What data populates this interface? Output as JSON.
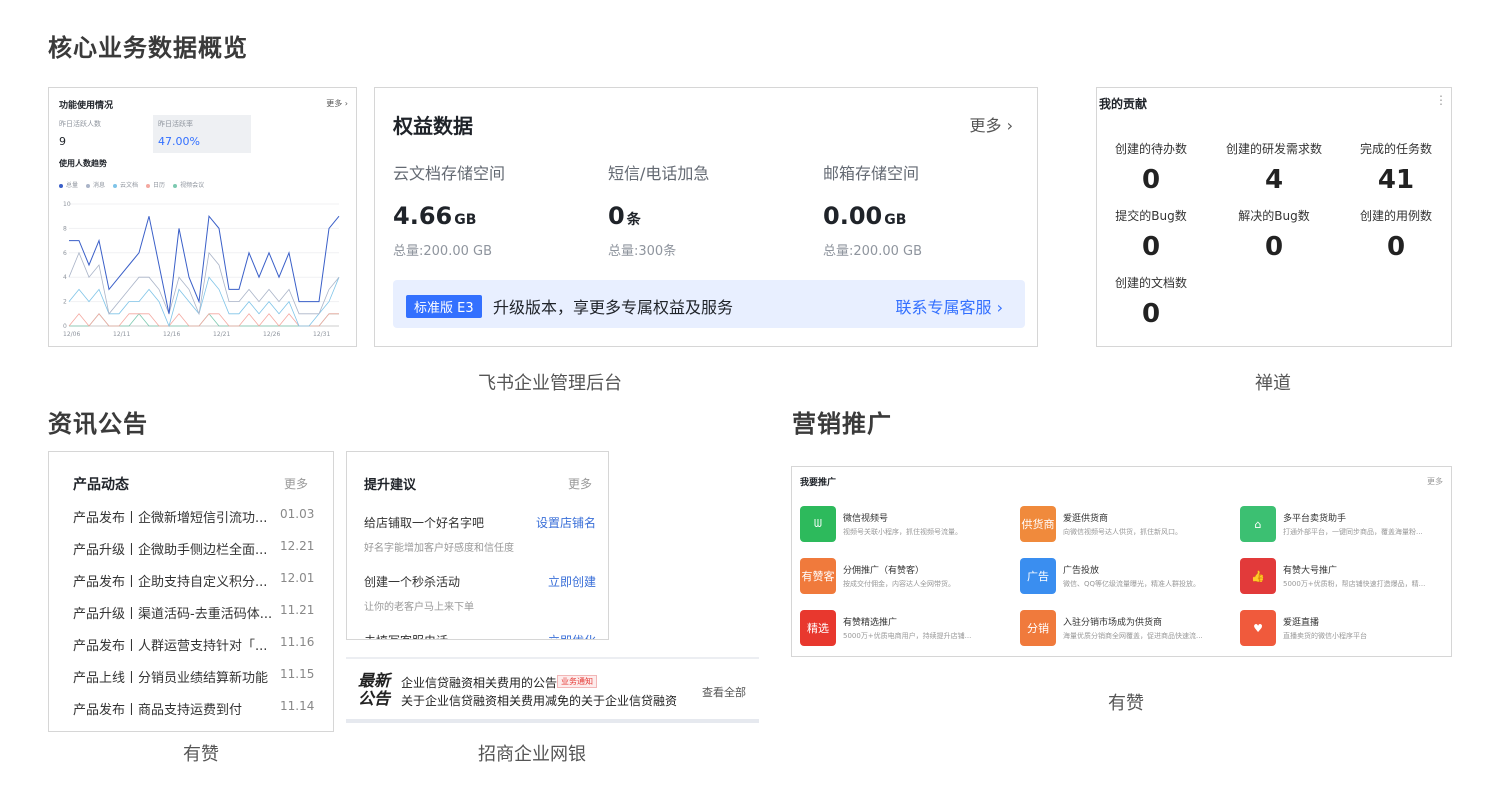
{
  "sections": {
    "core": "核心业务数据概览",
    "news": "资讯公告",
    "marketing": "营销推广"
  },
  "captions": {
    "feishu": "飞书企业管理后台",
    "chandao": "禅道",
    "youzan_news": "有赞",
    "cmb": "招商企业网银",
    "youzan_market": "有赞"
  },
  "usage_card": {
    "title": "功能使用情况",
    "more": "更多 ›",
    "stats": [
      {
        "label": "昨日活跃人数",
        "value": "9"
      },
      {
        "label": "昨日活跃率",
        "value": "47.00%"
      }
    ],
    "subtitle": "使用人数趋势",
    "legend": [
      "总量",
      "消息",
      "云文档",
      "日历",
      "视频会议"
    ],
    "colors": [
      "#3a5fc8",
      "#aab4c8",
      "#7fc4e8",
      "#f4a8a0",
      "#7cc9b0"
    ]
  },
  "chart_data": {
    "type": "line",
    "x_ticks": [
      "12/06",
      "12/11",
      "12/16",
      "12/21",
      "12/26",
      "12/31"
    ],
    "ylim": [
      0,
      10
    ],
    "y_ticks": [
      "0",
      "2",
      "4",
      "6",
      "8",
      "10"
    ],
    "series": [
      {
        "name": "总量",
        "values": [
          7,
          7,
          5,
          7,
          3,
          4,
          5,
          6,
          9,
          5,
          1,
          8,
          4,
          2,
          9,
          8,
          3,
          3,
          6,
          4,
          6,
          4,
          6,
          2,
          2,
          2,
          8,
          9
        ]
      },
      {
        "name": "消息",
        "values": [
          4,
          6,
          4,
          5,
          1,
          2,
          3,
          4,
          4,
          3,
          1,
          4,
          3,
          1,
          6,
          5,
          2,
          2,
          3,
          2,
          3,
          2,
          3,
          1,
          1,
          1,
          3,
          4
        ]
      },
      {
        "name": "云文档",
        "values": [
          2,
          3,
          2,
          3,
          1,
          1,
          2,
          2,
          3,
          2,
          0,
          3,
          2,
          1,
          4,
          3,
          1,
          1,
          2,
          1,
          2,
          1,
          2,
          0,
          0,
          1,
          2,
          4
        ]
      },
      {
        "name": "日历",
        "values": [
          0,
          1,
          0,
          1,
          0,
          0,
          1,
          1,
          1,
          0,
          0,
          1,
          0,
          0,
          1,
          1,
          0,
          0,
          1,
          0,
          1,
          0,
          1,
          0,
          0,
          0,
          1,
          1
        ]
      },
      {
        "name": "视频会议",
        "values": [
          0,
          0,
          0,
          1,
          0,
          0,
          0,
          1,
          0,
          0,
          0,
          0,
          0,
          0,
          1,
          0,
          0,
          0,
          0,
          0,
          0,
          0,
          0,
          0,
          0,
          0,
          1,
          1
        ]
      }
    ]
  },
  "rights_card": {
    "title": "权益数据",
    "more": "更多 ›",
    "cols": [
      {
        "label": "云文档存储空间",
        "value": "4.66",
        "unit": "GB",
        "total": "总量:200.00 GB"
      },
      {
        "label": "短信/电话加急",
        "value": "0",
        "unit": "条",
        "total": "总量:300条"
      },
      {
        "label": "邮箱存储空间",
        "value": "0.00",
        "unit": "GB",
        "total": "总量:200.00 GB"
      }
    ],
    "banner": {
      "badge": "标准版 E3",
      "text": "升级版本，享更多专属权益及服务",
      "link": "联系专属客服 ›"
    }
  },
  "contrib_card": {
    "title": "我的贡献",
    "menu": "⋮",
    "cells": [
      {
        "label": "创建的待办数",
        "value": "0"
      },
      {
        "label": "创建的研发需求数",
        "value": "4"
      },
      {
        "label": "完成的任务数",
        "value": "41"
      },
      {
        "label": "提交的Bug数",
        "value": "0"
      },
      {
        "label": "解决的Bug数",
        "value": "0"
      },
      {
        "label": "创建的用例数",
        "value": "0"
      },
      {
        "label": "创建的文档数",
        "value": "0"
      }
    ]
  },
  "product_news": {
    "title": "产品动态",
    "more": "更多",
    "rows": [
      {
        "text": "产品发布丨企微新增短信引流功...",
        "date": "01.03"
      },
      {
        "text": "产品升级丨企微助手侧边栏全面...",
        "date": "12.21"
      },
      {
        "text": "产品发布丨企助支持自定义积分...",
        "date": "12.01"
      },
      {
        "text": "产品升级丨渠道活码-去重活码体...",
        "date": "11.21"
      },
      {
        "text": "产品发布丨人群运营支持针对「...",
        "date": "11.16"
      },
      {
        "text": "产品上线丨分销员业绩结算新功能",
        "date": "11.15"
      },
      {
        "text": "产品发布丨商品支持运费到付",
        "date": "11.14"
      }
    ]
  },
  "suggest_card": {
    "title": "提升建议",
    "more": "更多",
    "items": [
      {
        "title": "给店铺取一个好名字吧",
        "desc": "好名字能增加客户好感度和信任度",
        "link": "设置店铺名"
      },
      {
        "title": "创建一个秒杀活动",
        "desc": "让你的老客户马上来下单",
        "link": "立即创建"
      },
      {
        "title": "未填写客服电话",
        "desc": "",
        "link": "立即优化"
      }
    ]
  },
  "cmb_notice": {
    "logo_line1": "最新",
    "logo_line2": "公告",
    "line1": "企业信贷融资相关费用的公告",
    "tag": "业务通知",
    "line2": "关于企业信贷融资相关费用减免的关于企业信贷融资",
    "view_all": "查看全部"
  },
  "promo_card": {
    "title": "我要推广",
    "more": "更多",
    "items": [
      {
        "name": "微信视频号",
        "desc": "视频号关联小程序，抓住视频号流量。",
        "icon": "wechat-channels-icon",
        "color": "#2dba5c",
        "glyph": "ᗯ"
      },
      {
        "name": "爱逛供货商",
        "desc": "向微信视频号达人供货，抓住新风口。",
        "icon": "supplier-icon",
        "color": "#f08a3c",
        "glyph": "供货商"
      },
      {
        "name": "多平台卖货助手",
        "desc": "打通外部平台，一键同步商品，覆盖海量粉...",
        "icon": "multi-platform-icon",
        "color": "#3cc072",
        "glyph": "⌂"
      },
      {
        "name": "分佣推广（有赞客）",
        "desc": "按成交付佣金，内容达人全网带货。",
        "icon": "affiliate-icon",
        "color": "#f07a3c",
        "glyph": "有赞客"
      },
      {
        "name": "广告投放",
        "desc": "微信、QQ等亿级流量曝光，精准人群投放。",
        "icon": "ads-icon",
        "color": "#3a8ef0",
        "glyph": "广告"
      },
      {
        "name": "有赞大号推广",
        "desc": "5000万+优质粉，帮店铺快速打造爆品，精...",
        "icon": "thumb-icon",
        "color": "#e23a3a",
        "glyph": "👍"
      },
      {
        "name": "有赞精选推广",
        "desc": "5000万+优质电商用户，持续提升店铺...",
        "icon": "selection-icon",
        "color": "#e8382e",
        "glyph": "精选"
      },
      {
        "name": "入驻分销市场成为供货商",
        "desc": "海量优质分销商全网覆盖，促进商品快速流...",
        "icon": "distribution-icon",
        "color": "#f07a3c",
        "glyph": "分销"
      },
      {
        "name": "爱逛直播",
        "desc": "直播卖货的微信小程序平台",
        "icon": "live-icon",
        "color": "#f05a3c",
        "glyph": "♥"
      }
    ]
  }
}
